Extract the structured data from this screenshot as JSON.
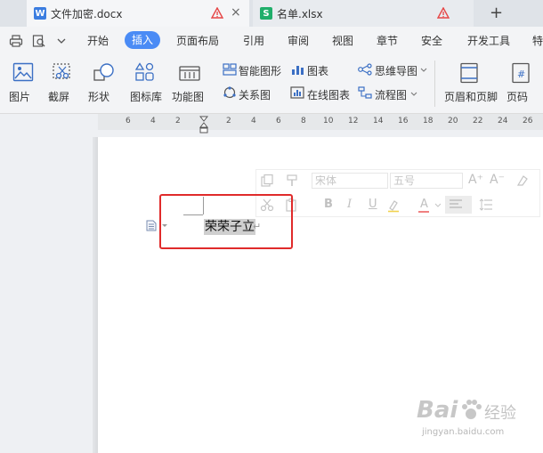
{
  "tabs": [
    {
      "icon": "W",
      "name": "文件加密.docx",
      "close": "×"
    },
    {
      "icon": "S",
      "name": "名单.xlsx"
    }
  ],
  "new_tab": "+",
  "menu": {
    "items": [
      "开始",
      "插入",
      "页面布局",
      "引用",
      "审阅",
      "视图",
      "章节",
      "安全",
      "开发工具",
      "特"
    ],
    "active": "插入"
  },
  "ribbon": {
    "picture": "图片",
    "screenshot": "截屏",
    "shape": "形状",
    "icon_lib": "图标库",
    "func_chart": "功能图",
    "smart_shape": "智能图形",
    "chart": "图表",
    "mindmap": "思维导图",
    "relation": "关系图",
    "online_chart": "在线图表",
    "flowchart": "流程图",
    "header_footer": "页眉和页脚",
    "page_number": "页码"
  },
  "ruler_ticks": [
    "6",
    "4",
    "2",
    "2",
    "4",
    "6",
    "8",
    "10",
    "12",
    "14",
    "16",
    "18",
    "20",
    "22",
    "24",
    "26"
  ],
  "mini_toolbar": {
    "font": "宋体",
    "size": "五号",
    "bold": "B",
    "italic": "I",
    "underline": "U",
    "font_color": "A",
    "grow": "A⁺",
    "shrink": "A⁻"
  },
  "document": {
    "selected_text": "荣荣子立",
    "para_mark": "↵"
  },
  "watermark": {
    "brand": "Bai",
    "brand2": "经验",
    "url": "jingyan.baidu.com"
  },
  "colors": {
    "accent": "#4a8bf5",
    "highlight_box": "#e02b2b",
    "word_icon": "#3b7de0",
    "excel_icon": "#1fae6a",
    "warning": "#e64545"
  }
}
